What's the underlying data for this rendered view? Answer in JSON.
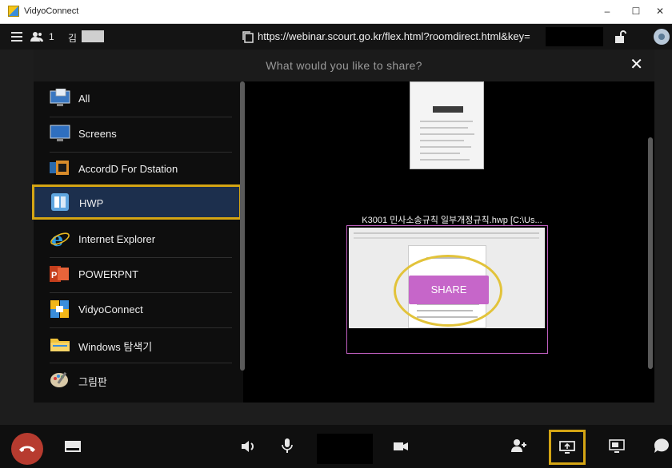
{
  "window": {
    "title": "VidyoConnect",
    "controls": {
      "minimize": "–",
      "maximize": "☐",
      "close": "✕"
    }
  },
  "toolbar": {
    "participant_count": "1",
    "user_name_initial": "김",
    "url": "https://webinar.scourt.go.kr/flex.html?roomdirect.html&key="
  },
  "dialog": {
    "title": "What would you like to share?",
    "close": "✕",
    "sources": [
      {
        "label": "All",
        "icon": "all-windows-icon"
      },
      {
        "label": "Screens",
        "icon": "monitor-icon"
      },
      {
        "label": "AccordD For Dstation",
        "icon": "accordd-app-icon"
      },
      {
        "label": "HWP",
        "icon": "hwp-app-icon",
        "selected": true
      },
      {
        "label": "Internet Explorer",
        "icon": "internet-explorer-icon"
      },
      {
        "label": "POWERPNT",
        "icon": "powerpoint-icon"
      },
      {
        "label": "VidyoConnect",
        "icon": "vidyoconnect-icon"
      },
      {
        "label": "Windows 탐색기",
        "icon": "file-explorer-icon"
      },
      {
        "label": "그림판",
        "icon": "paint-icon"
      }
    ],
    "window_caption": "K3001 민사소송규칙 일부개정규칙.hwp [C:\\Us...",
    "share_button": "SHARE"
  },
  "colors": {
    "highlight": "#d4a514",
    "selected_bg": "#1c2f4d",
    "share_button": "#c666c9",
    "hangup": "#b73b2f"
  }
}
